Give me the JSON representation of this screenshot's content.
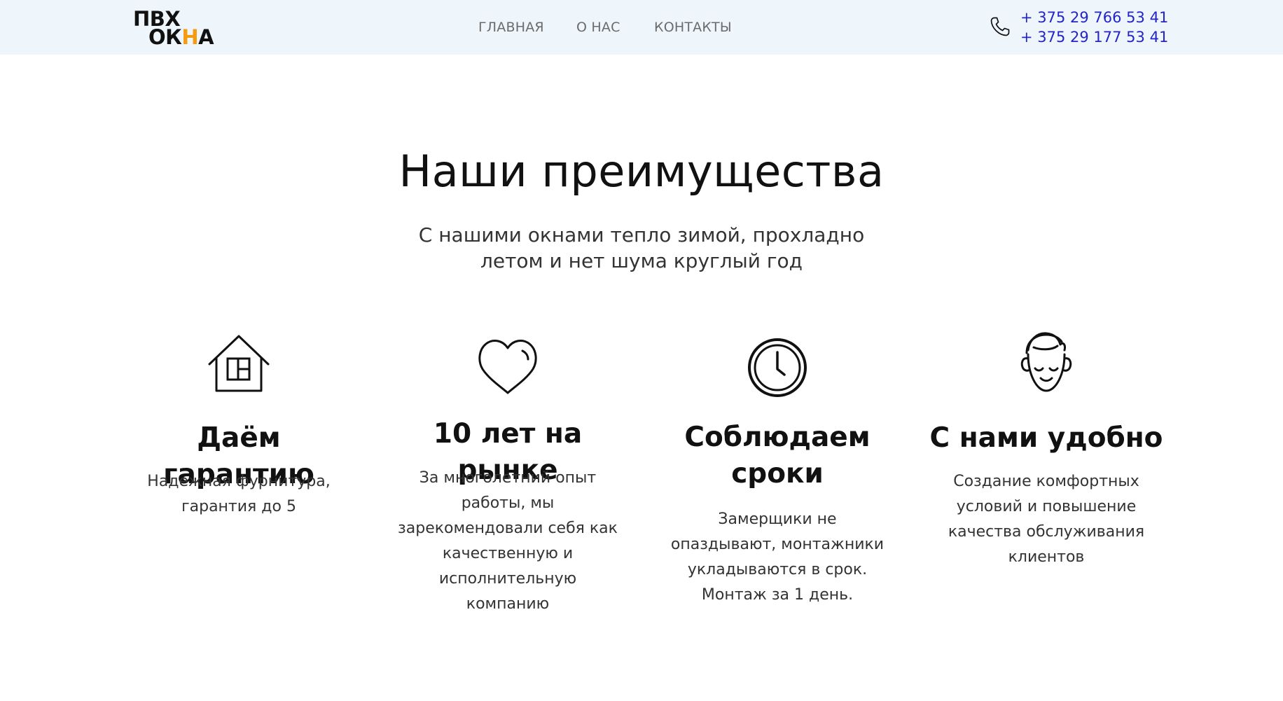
{
  "header": {
    "logo_line1": "ПВХ",
    "logo_line2_a": "ОК",
    "logo_line2_b": "Н",
    "logo_line2_c": "А",
    "logo_accent_color": "#f39c12",
    "nav": [
      {
        "label": "ГЛАВНАЯ"
      },
      {
        "label": "О НАС"
      },
      {
        "label": "КОНТАКТЫ"
      }
    ],
    "phones": [
      "+ 375 29 766 53 41",
      "+ 375 29 177 53 41"
    ],
    "phone_icon": "phone-icon",
    "background_color": "#eef6fc",
    "link_color": "#2424c8"
  },
  "section": {
    "title": "Наши преимущества",
    "subtitle": "С нашими окнами тепло зимой, прохладно летом и нет шума круглый год"
  },
  "features": [
    {
      "icon": "house-icon",
      "title": "Даём гарантию",
      "description": "Надежная фурнитура, гарантия до 5"
    },
    {
      "icon": "heart-icon",
      "title": "10 лет на рынке",
      "description": "За многолетний опыт работы, мы зарекомендовали себя как качественную и исполнительную компанию"
    },
    {
      "icon": "clock-icon",
      "title": "Соблюдаем сроки",
      "description": "Замерщики не опаздывают, монтажники укладываются в срок. Монтаж за 1 день."
    },
    {
      "icon": "smiling-face-icon",
      "title": "С нами удобно",
      "description": "Создание комфортных условий и повышение качества обслуживания клиентов"
    }
  ]
}
